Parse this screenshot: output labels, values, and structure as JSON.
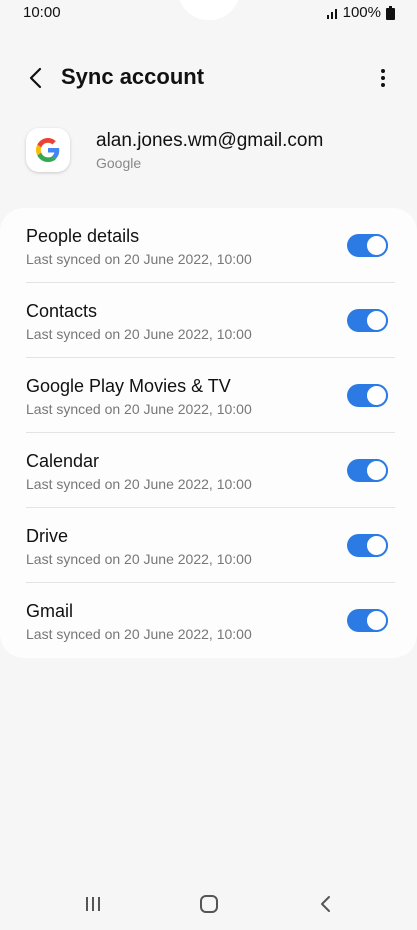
{
  "status_bar": {
    "time": "10:00",
    "battery": "100%"
  },
  "header": {
    "title": "Sync account"
  },
  "account": {
    "email": "alan.jones.wm@gmail.com",
    "provider": "Google"
  },
  "sync_items": [
    {
      "title": "People details",
      "subtitle": "Last synced on 20 June 2022, 10:00",
      "enabled": true
    },
    {
      "title": "Contacts",
      "subtitle": "Last synced on 20 June 2022, 10:00",
      "enabled": true
    },
    {
      "title": "Google Play Movies & TV",
      "subtitle": "Last synced on 20 June 2022, 10:00",
      "enabled": true
    },
    {
      "title": "Calendar",
      "subtitle": "Last synced on 20 June 2022, 10:00",
      "enabled": true
    },
    {
      "title": "Drive",
      "subtitle": "Last synced on 20 June 2022, 10:00",
      "enabled": true
    },
    {
      "title": "Gmail",
      "subtitle": "Last synced on 20 June 2022, 10:00",
      "enabled": true
    }
  ],
  "colors": {
    "accent": "#2c7be5",
    "background": "#f6f6f6",
    "card": "#fdfdfd"
  },
  "icons": {
    "back": "back-arrow-icon",
    "more": "more-vertical-icon",
    "signal": "signal-icon",
    "battery": "battery-icon",
    "nav_recents": "recents-icon",
    "nav_home": "home-icon",
    "nav_back": "nav-back-icon"
  }
}
